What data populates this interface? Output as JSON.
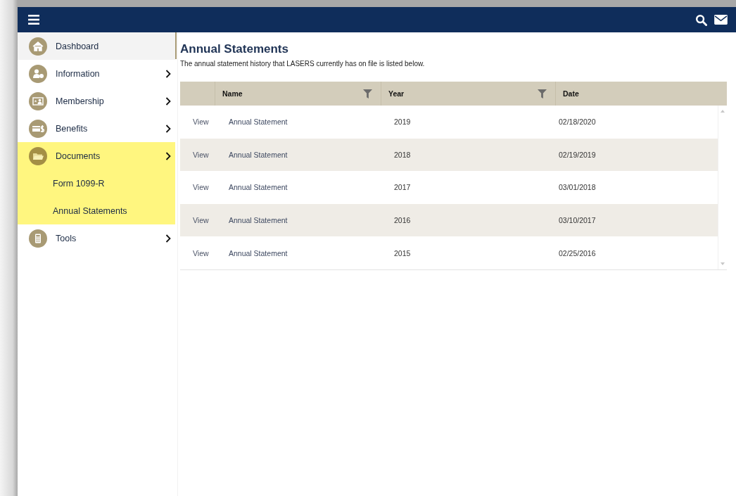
{
  "sidebar": {
    "items": [
      {
        "label": "Dashboard",
        "hovered": true,
        "has_submenu": false,
        "expanded": false
      },
      {
        "label": "Information",
        "hovered": false,
        "has_submenu": true,
        "expanded": false
      },
      {
        "label": "Membership",
        "hovered": false,
        "has_submenu": true,
        "expanded": false
      },
      {
        "label": "Benefits",
        "hovered": false,
        "has_submenu": true,
        "expanded": false
      },
      {
        "label": "Documents",
        "hovered": false,
        "has_submenu": true,
        "expanded": true,
        "children": [
          {
            "label": "Form 1099-R"
          },
          {
            "label": "Annual Statements"
          }
        ]
      },
      {
        "label": "Tools",
        "hovered": false,
        "has_submenu": true,
        "expanded": false
      }
    ]
  },
  "page": {
    "title": "Annual Statements",
    "description": "The annual statement history that LASERS currently has on file is listed below."
  },
  "table": {
    "columns": [
      {
        "filter": false
      },
      {
        "label": "Name",
        "filter": true
      },
      {
        "label": "Year",
        "filter": true
      },
      {
        "label": "Date",
        "filter": false
      }
    ],
    "rows": [
      {
        "action": "View",
        "name": "Annual Statement",
        "year": "2019",
        "date": "02/18/2020"
      },
      {
        "action": "View",
        "name": "Annual Statement",
        "year": "2018",
        "date": "02/19/2019"
      },
      {
        "action": "View",
        "name": "Annual Statement",
        "year": "2017",
        "date": "03/01/2018"
      },
      {
        "action": "View",
        "name": "Annual Statement",
        "year": "2016",
        "date": "03/10/2017"
      },
      {
        "action": "View",
        "name": "Annual Statement",
        "year": "2015",
        "date": "02/25/2016"
      }
    ]
  }
}
